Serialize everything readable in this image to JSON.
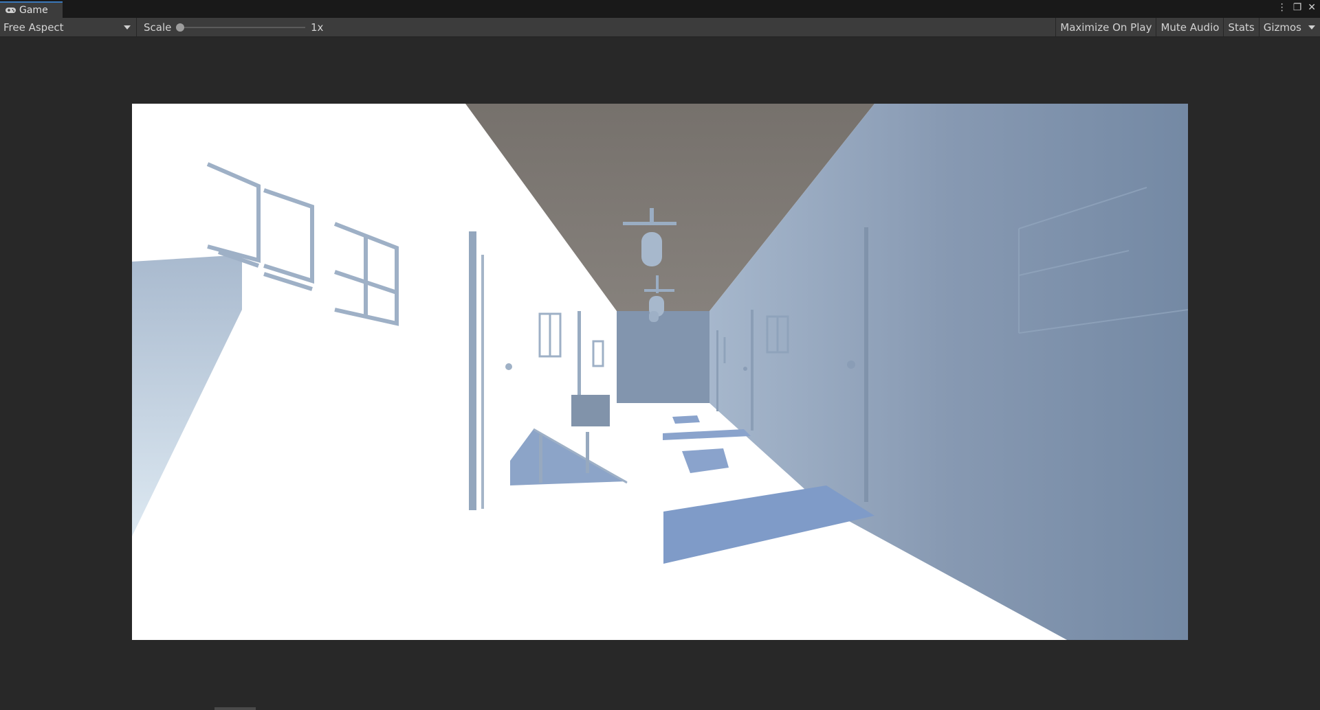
{
  "tab": {
    "title": "Game",
    "icon": "gamepad-icon"
  },
  "window_controls": {
    "menu_icon": "⋮",
    "maximize_icon": "❐",
    "close_icon": "✕"
  },
  "toolbar": {
    "aspect_label": "Free Aspect",
    "scale_label": "Scale",
    "scale_value": "1x",
    "scale_fraction": 0.0,
    "maximize_on_play": "Maximize On Play",
    "mute_audio": "Mute Audio",
    "stats": "Stats",
    "gizmos": "Gizmos"
  },
  "colors": {
    "accent": "#3a79bb",
    "ceiling": "#79746f",
    "wall_shadow": "#7f93ad",
    "floor_lit": "#ffffff"
  }
}
